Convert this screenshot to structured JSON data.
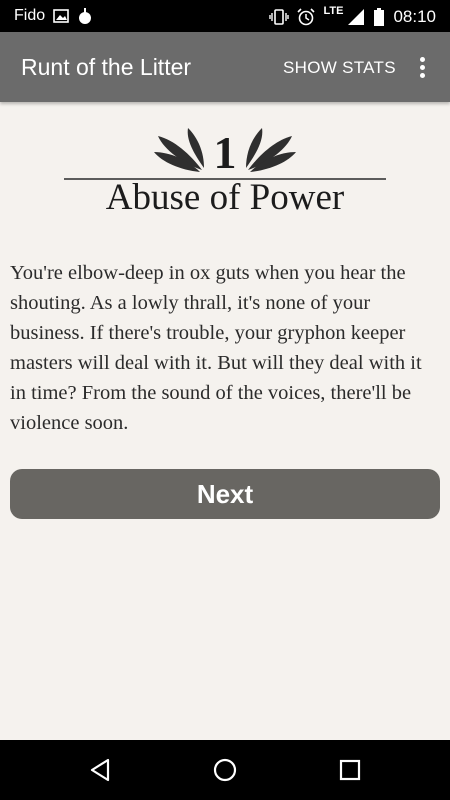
{
  "status_bar": {
    "carrier": "Fido",
    "network": "LTE",
    "time": "08:10"
  },
  "app_bar": {
    "title": "Runt of the Litter",
    "show_stats_label": "SHOW STATS"
  },
  "chapter": {
    "number": "1",
    "title": "Abuse of Power"
  },
  "story": {
    "text": "You're elbow-deep in ox guts when you hear the shouting. As a lowly thrall, it's none of your business. If there's trouble, your gryphon keeper masters will deal with it. But will they deal with it in time? From the sound of the voices, there'll be violence soon."
  },
  "next_button": {
    "label": "Next"
  },
  "colors": {
    "app_bar": "#6b6b6b",
    "background": "#f5f2ee",
    "button": "#686662"
  }
}
